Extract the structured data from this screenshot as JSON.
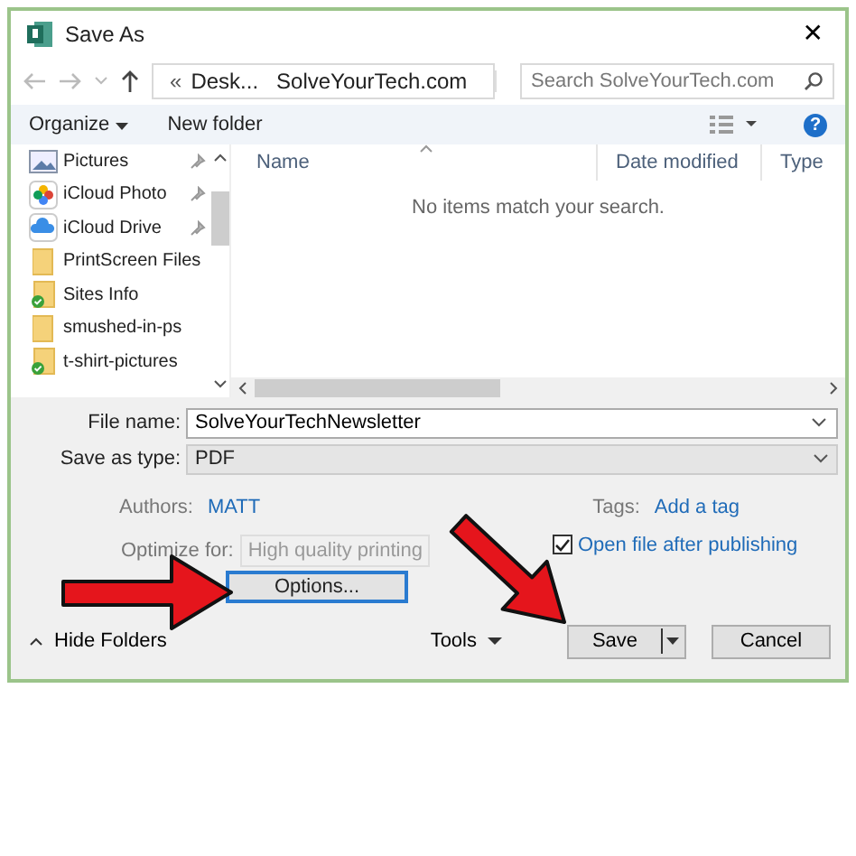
{
  "window": {
    "title": "Save As",
    "close": "✕"
  },
  "address": {
    "overflow": "«",
    "crumbs": [
      "Desk...",
      "SolveYourTech.com"
    ],
    "search_placeholder": "Search SolveYourTech.com"
  },
  "toolbar": {
    "organize": "Organize",
    "new_folder": "New folder",
    "help": "?"
  },
  "sidebar": {
    "items": [
      {
        "label": "Pictures",
        "kind": "pictures",
        "pinned": true
      },
      {
        "label": "iCloud Photo",
        "kind": "photos",
        "pinned": true
      },
      {
        "label": "iCloud Drive",
        "kind": "cloud",
        "pinned": true
      },
      {
        "label": "PrintScreen Files",
        "kind": "folder",
        "pinned": false
      },
      {
        "label": "Sites Info",
        "kind": "synced-folder",
        "pinned": false
      },
      {
        "label": "smushed-in-ps",
        "kind": "folder",
        "pinned": false
      },
      {
        "label": "t-shirt-pictures",
        "kind": "synced-folder",
        "pinned": false
      }
    ]
  },
  "file_list": {
    "columns": [
      "Name",
      "Date modified",
      "Type"
    ],
    "empty_message": "No items match your search."
  },
  "form": {
    "file_name_label": "File name:",
    "file_name": "SolveYourTechNewsletter",
    "type_label": "Save as type:",
    "type": "PDF",
    "authors_label": "Authors:",
    "authors": "MATT",
    "tags_label": "Tags:",
    "tags": "Add a tag",
    "optimize_label": "Optimize for:",
    "optimize": "High quality printing",
    "open_after": {
      "label": "Open file after publishing",
      "checked": true
    },
    "options_button": "Options..."
  },
  "footer": {
    "hide_folders": "Hide Folders",
    "tools": "Tools",
    "save": "Save",
    "cancel": "Cancel"
  }
}
